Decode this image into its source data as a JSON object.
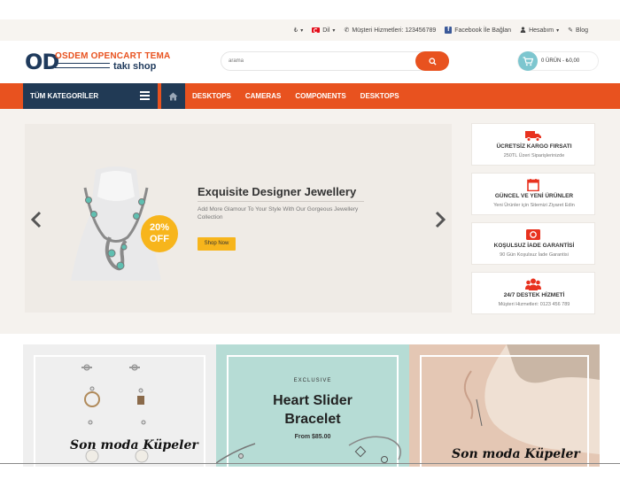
{
  "topbar": {
    "currency_icon": "currency-icon",
    "language_label": "Dil",
    "phone_label": "Müşteri Hizmetleri: 123456789",
    "facebook_label": "Facebook İle Bağlan",
    "account_label": "Hesabım",
    "blog_label": "Blog"
  },
  "header": {
    "logo_initials": "OD",
    "logo_title": "OSDEM OPENCART TEMA",
    "logo_subtitle": "takı shop",
    "search_placeholder": "arama",
    "cart_label": "0 ÜRÜN - ₺0,00"
  },
  "nav": {
    "categories_label": "TÜM KATEGORİLER",
    "links": [
      "DESKTOPS",
      "CAMERAS",
      "COMPONENTS",
      "DESKTOPS"
    ]
  },
  "slider": {
    "badge_line1": "20%",
    "badge_line2": "OFF",
    "title": "Exquisite Designer Jewellery",
    "subtitle": "Add More Glamour To Your Style With Our Gorgeous Jewellery Collection",
    "button_label": "Shop Now"
  },
  "features": [
    {
      "icon": "truck-icon",
      "title": "ÜCRETSİZ KARGO FIRSATI",
      "subtitle": "250TL Üzeri Siparişlerinizde"
    },
    {
      "icon": "calendar-icon",
      "title": "GÜNCEL VE YENİ ÜRÜNLER",
      "subtitle": "Yeni Ürünler için Sitemizi Ziyaret Edin"
    },
    {
      "icon": "money-icon",
      "title": "KOŞULSUZ İADE GARANTİSİ",
      "subtitle": "90 Gün Koşulsuz İade Garantisi"
    },
    {
      "icon": "users-icon",
      "title": "24/7 DESTEK HİZMETİ",
      "subtitle": "Müşteri Hizmetleri: 0123 456 789"
    }
  ],
  "banners": {
    "left_script": "Son moda Küpeler",
    "center_tag": "EXCLUSIVE",
    "center_title_line1": "Heart Slider",
    "center_title_line2": "Bracelet",
    "center_price": "From $85.00",
    "right_script": "Son moda Küpeler"
  },
  "colors": {
    "accent": "#e8521f",
    "navy": "#213a55",
    "yellow": "#f7b51c",
    "teal": "#b6dcd5"
  }
}
